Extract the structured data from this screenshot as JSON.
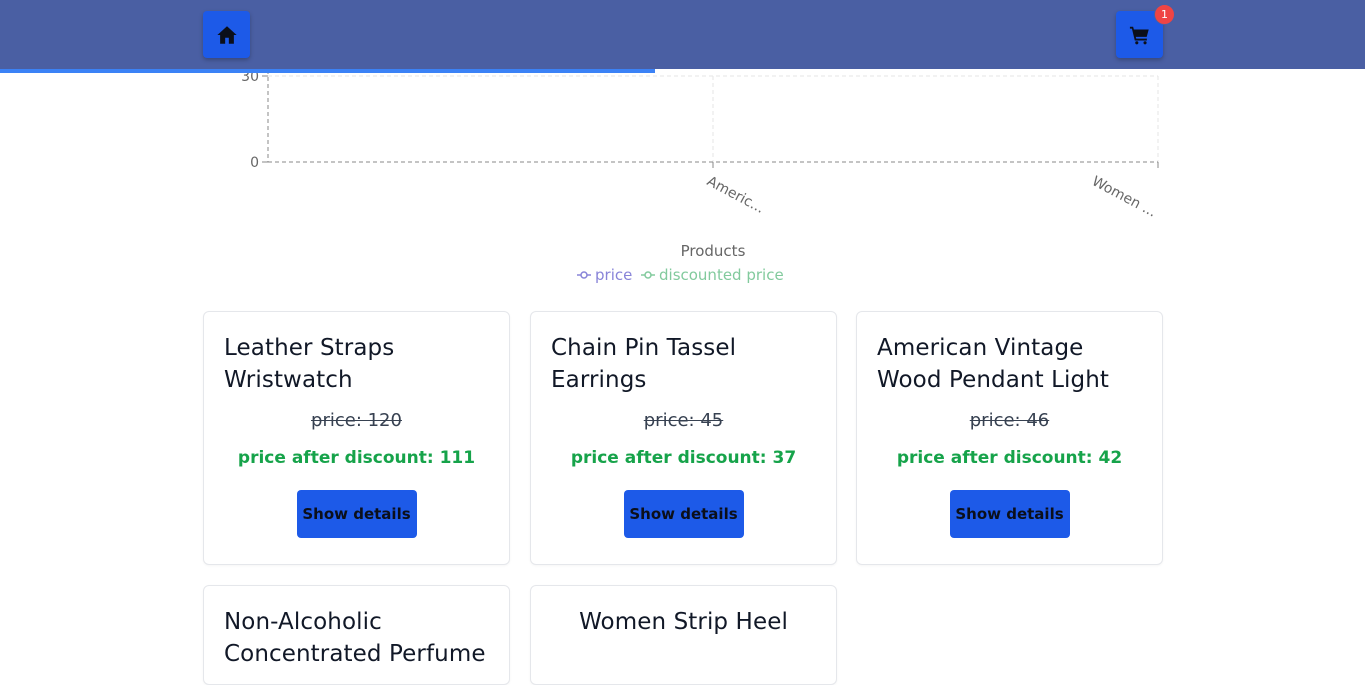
{
  "navbar": {
    "home_icon": "home-icon",
    "cart_icon": "cart-icon",
    "cart_count": "1",
    "accent": "#4a5fa3",
    "button_color": "#1d5ae8"
  },
  "scroll_progress": 0.48,
  "chart_data": {
    "type": "line",
    "categories": [
      "Americ...",
      "Women ..."
    ],
    "xlabel": "Products",
    "y_ticks": [
      "0",
      "30"
    ],
    "series": [
      {
        "name": "price",
        "color": "#8884d8"
      },
      {
        "name": "discounted price",
        "color": "#82ca9d"
      }
    ],
    "grid": "dashed"
  },
  "products": [
    {
      "title": "Leather Straps Wristwatch",
      "price": "price: 120",
      "discount": "price after discount: 111",
      "button": "Show details"
    },
    {
      "title": "Chain Pin Tassel Earrings",
      "price": "price: 45",
      "discount": "price after discount: 37",
      "button": "Show details"
    },
    {
      "title": "American Vintage Wood Pendant Light",
      "price": "price: 46",
      "discount": "price after discount: 42",
      "button": "Show details"
    },
    {
      "title": "Non-Alcoholic Concentrated Perfume",
      "price": "",
      "discount": "",
      "button": ""
    },
    {
      "title": "Women Strip Heel",
      "price": "",
      "discount": "",
      "button": ""
    }
  ]
}
